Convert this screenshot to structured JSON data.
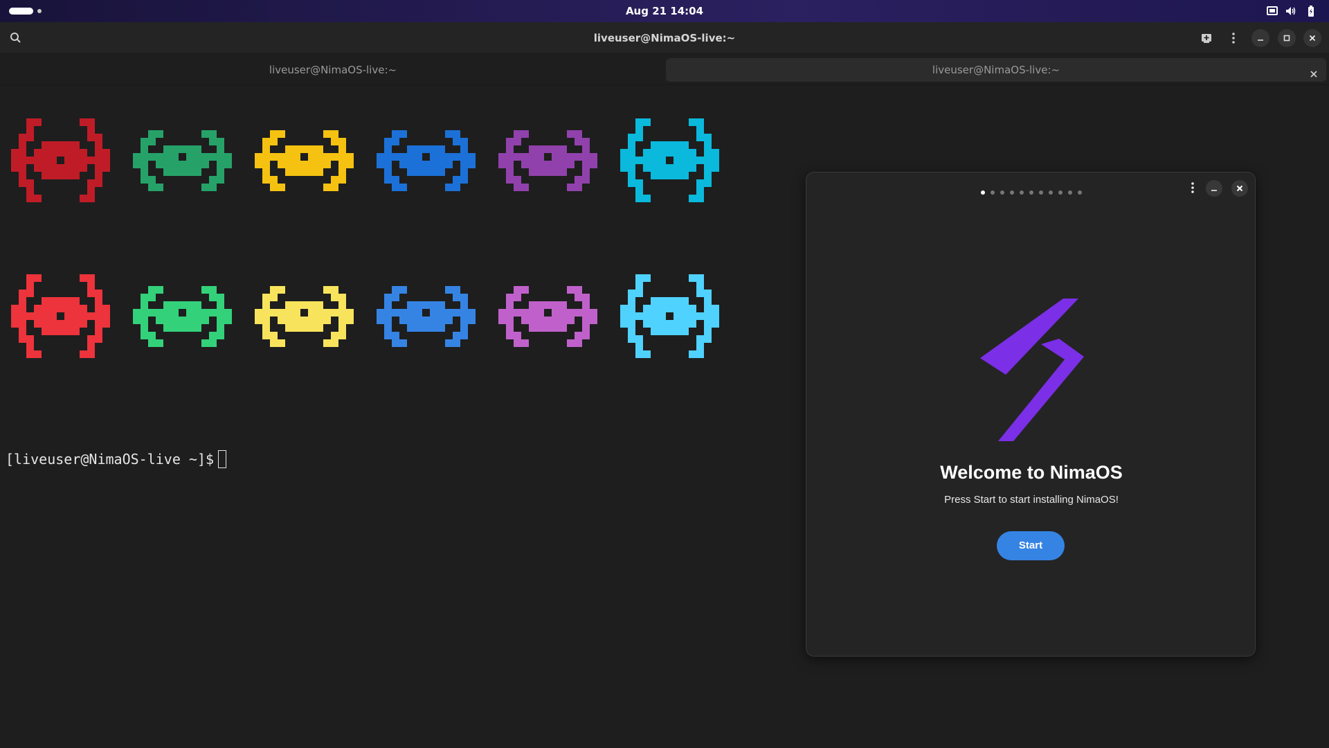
{
  "topbar": {
    "clock": "Aug 21  14:04",
    "icons": [
      "workspace-indicator",
      "screen-icon",
      "volume-icon",
      "battery-icon"
    ]
  },
  "terminal": {
    "title": "liveuser@NimaOS-live:~",
    "tabs": [
      {
        "label": "liveuser@NimaOS-live:~",
        "active": false
      },
      {
        "label": "liveuser@NimaOS-live:~",
        "active": true
      }
    ],
    "prompt": "[liveuser@NimaOS-live ~]$",
    "invader_colors": {
      "row1": [
        "#c01c28",
        "#26a269",
        "#f5c211",
        "#1c71d8",
        "#9141ac",
        "#0ab9dc"
      ],
      "row2": [
        "#ed333b",
        "#33d17a",
        "#f8e45c",
        "#3584e4",
        "#c061cb",
        "#4fd2fd"
      ]
    },
    "header_icons": [
      "search-icon",
      "new-tab-icon",
      "menu-icon",
      "minimize-icon",
      "maximize-icon",
      "close-icon"
    ]
  },
  "welcome": {
    "title": "Welcome to NimaOS",
    "subtitle": "Press Start to start installing NimaOS!",
    "start_label": "Start",
    "pages": 11,
    "current_page": 1,
    "logo_color": "#7b2fe6",
    "accent": "#3584e4"
  }
}
